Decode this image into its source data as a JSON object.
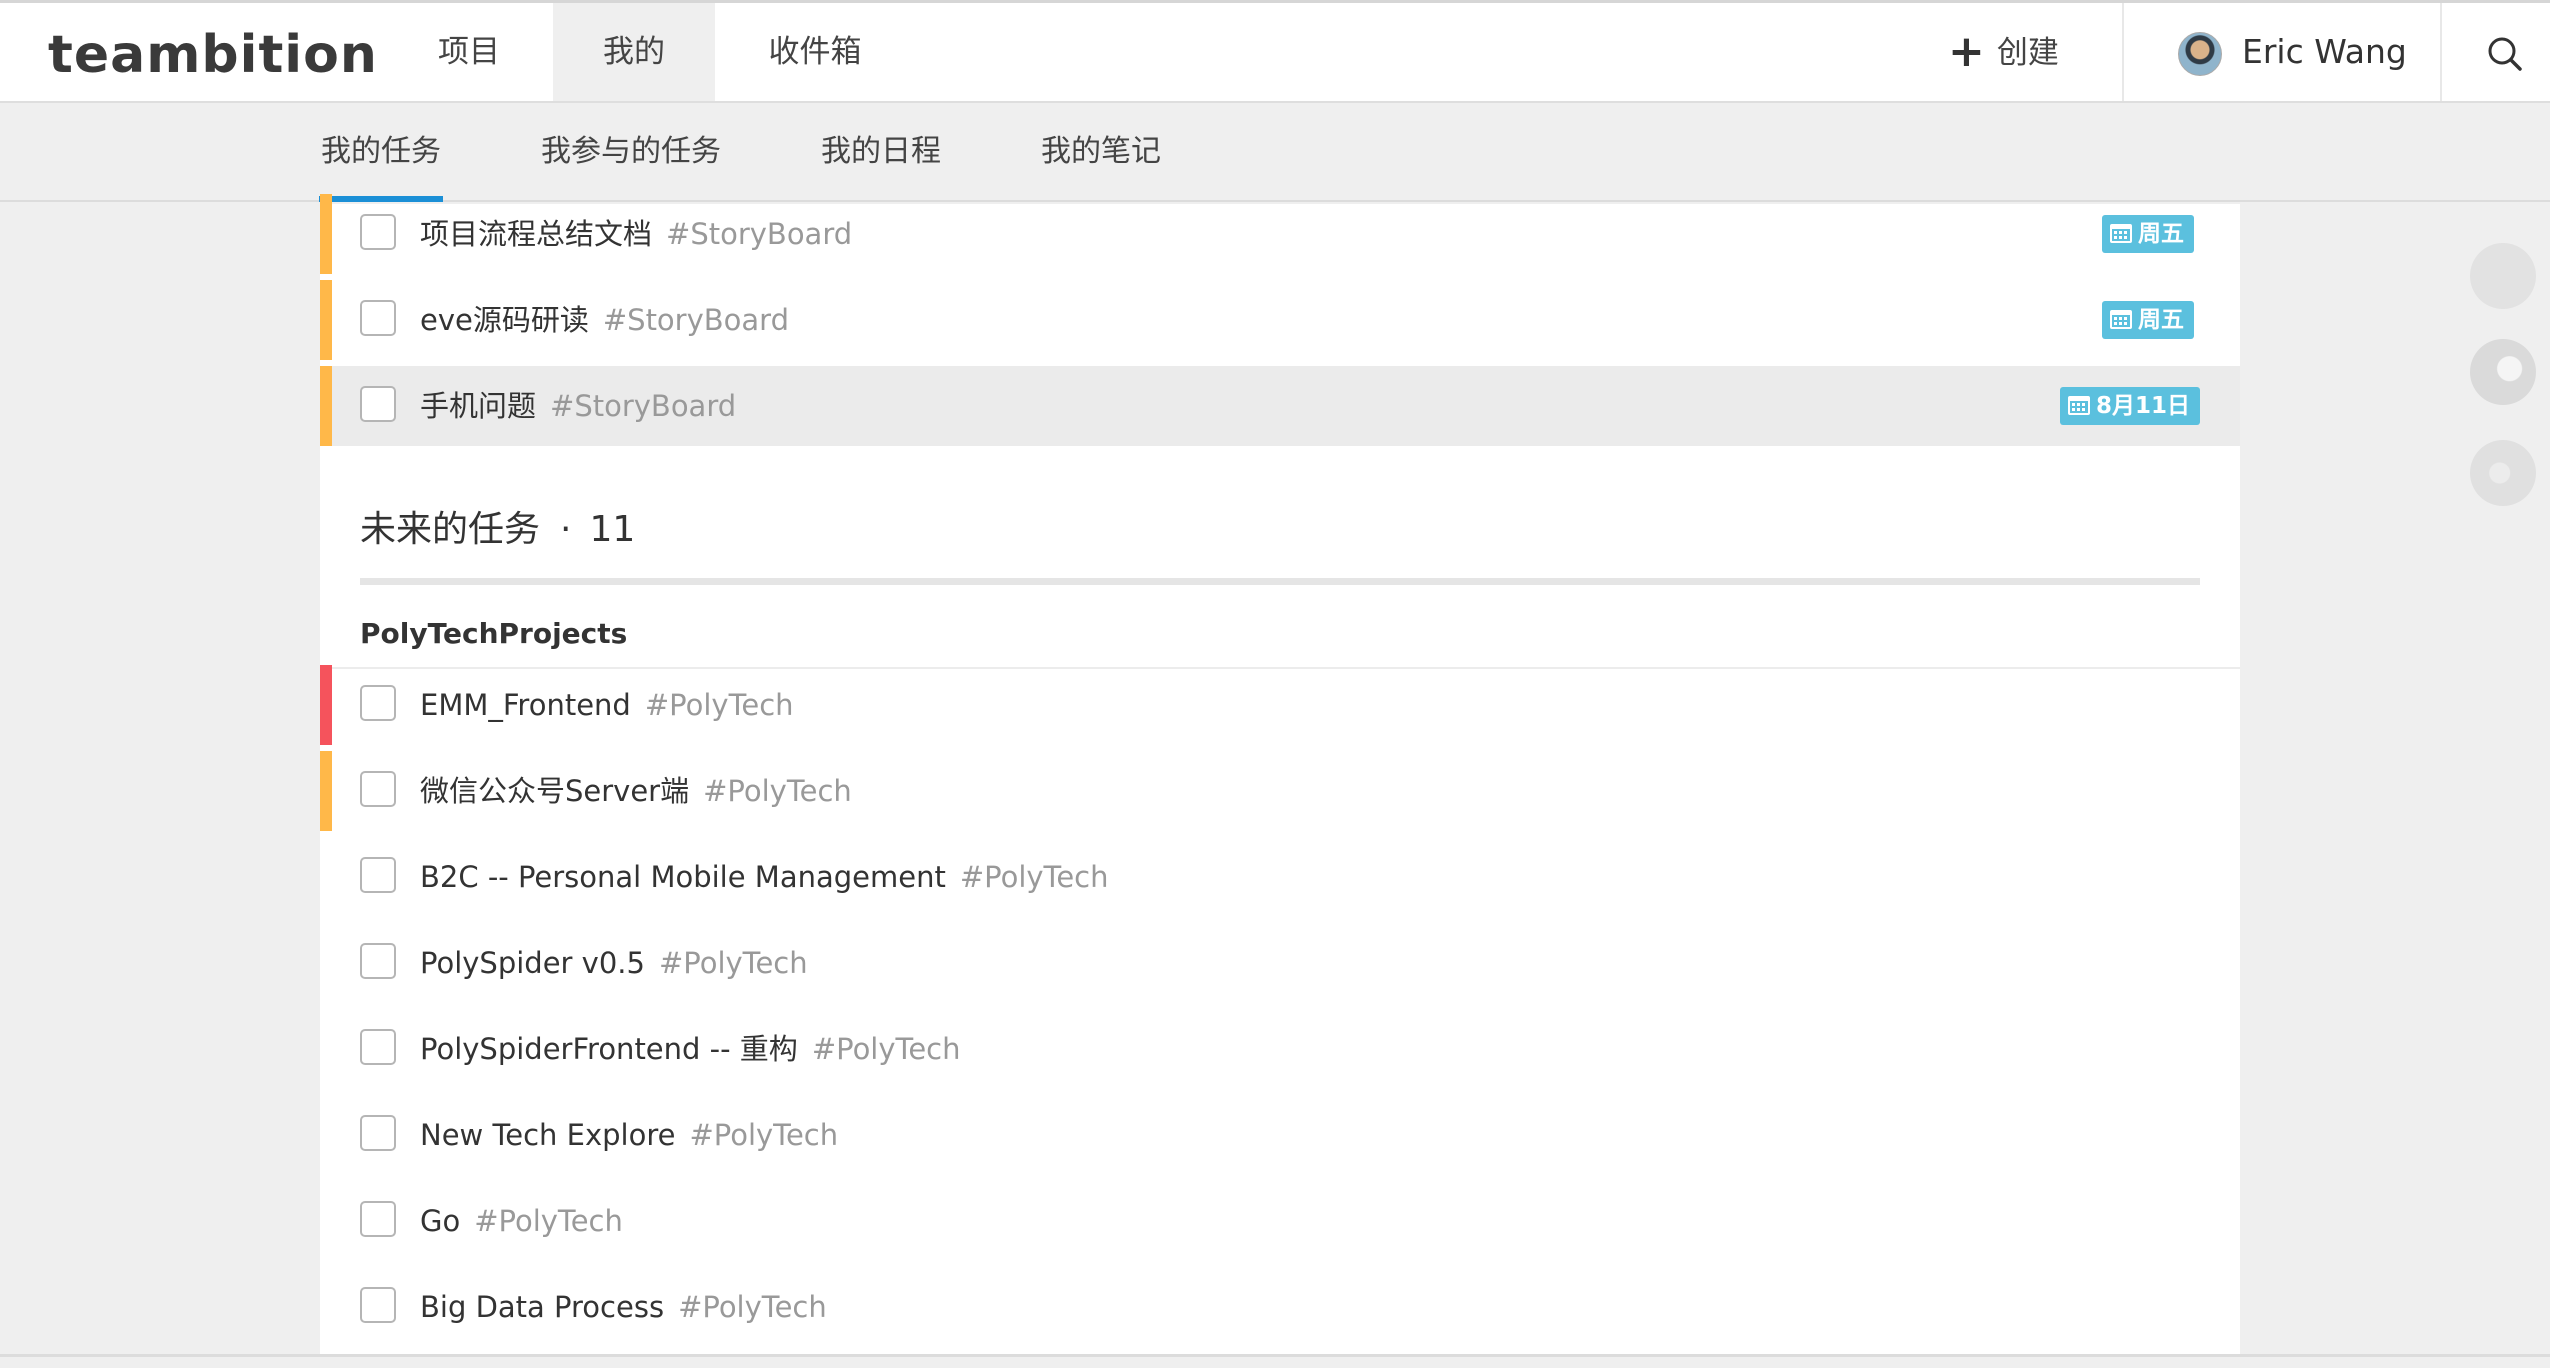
{
  "app": {
    "logo": "teambition"
  },
  "header": {
    "nav": [
      {
        "label": "项目"
      },
      {
        "label": "我的"
      },
      {
        "label": "收件箱"
      }
    ],
    "create_label": "创建",
    "user_name": "Eric Wang",
    "icons": {
      "create": "plus-icon",
      "search": "search-icon"
    }
  },
  "subnav": {
    "tabs": [
      {
        "label": "我的任务"
      },
      {
        "label": "我参与的任务"
      },
      {
        "label": "我的日程"
      },
      {
        "label": "我的笔记"
      }
    ]
  },
  "colors": {
    "accent": "#1b8fd6",
    "due_badge": "#5bc0de",
    "priority_high": "#f5535c",
    "priority_medium": "#ffb849",
    "background": "#efefef"
  },
  "current_tasks": [
    {
      "name": "项目流程总结文档",
      "project": "#StoryBoard",
      "due": "周五",
      "priority": "medium"
    },
    {
      "name": "eve源码研读",
      "project": "#StoryBoard",
      "due": "周五",
      "priority": "medium"
    },
    {
      "name": "手机问题",
      "project": "#StoryBoard",
      "due": "8月11日",
      "priority": "medium"
    }
  ],
  "future": {
    "title": "未来的任务",
    "separator": "·",
    "count": "11",
    "group_name": "PolyTechProjects",
    "tasks": [
      {
        "name": "EMM_Frontend",
        "project": "#PolyTech",
        "priority": "high"
      },
      {
        "name": "微信公众号Server端",
        "project": "#PolyTech",
        "priority": "medium"
      },
      {
        "name": "B2C -- Personal Mobile Management",
        "project": "#PolyTech",
        "priority": "none"
      },
      {
        "name": "PolySpider v0.5",
        "project": "#PolyTech",
        "priority": "none"
      },
      {
        "name": "PolySpiderFrontend -- 重构",
        "project": "#PolyTech",
        "priority": "none"
      },
      {
        "name": "New Tech Explore",
        "project": "#PolyTech",
        "priority": "none"
      },
      {
        "name": "Go",
        "project": "#PolyTech",
        "priority": "none"
      },
      {
        "name": "Big Data Process",
        "project": "#PolyTech",
        "priority": "none"
      }
    ]
  }
}
